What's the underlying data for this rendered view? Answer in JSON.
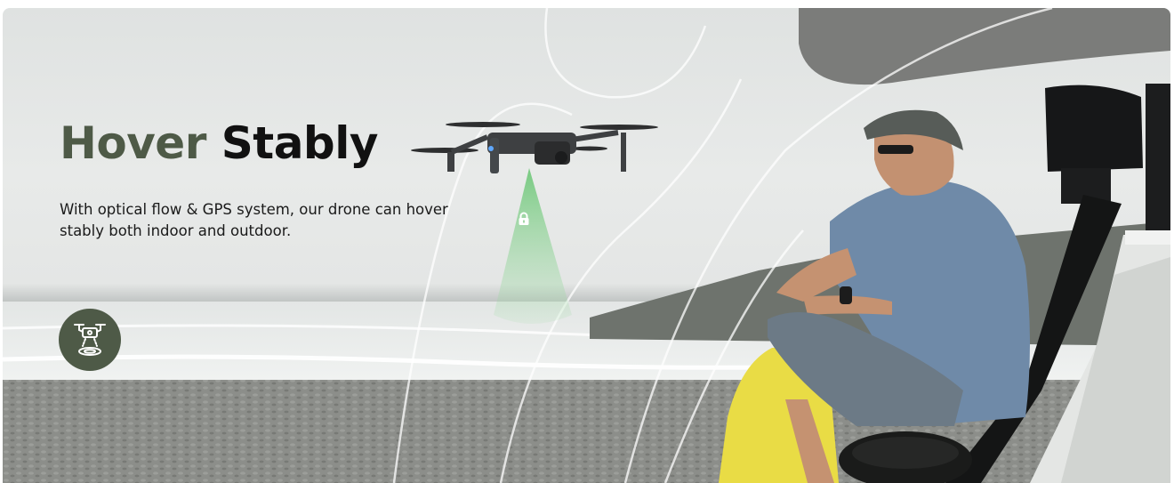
{
  "banner": {
    "title_word1": "Hover",
    "title_word2": "Stably",
    "description": "With optical flow & GPS system, our drone can hover stably both indoor and outdoor.",
    "feature_icon": "hovering-drone-icon",
    "overlay_icon": "lock-icon"
  },
  "colors": {
    "title_accent": "#4e5a47",
    "title_main": "#111111",
    "badge_bg": "#4e5a47",
    "dark_shape": "#7b7c7a",
    "yellow_shape": "#e9dc45",
    "beam": "#7ed087"
  }
}
